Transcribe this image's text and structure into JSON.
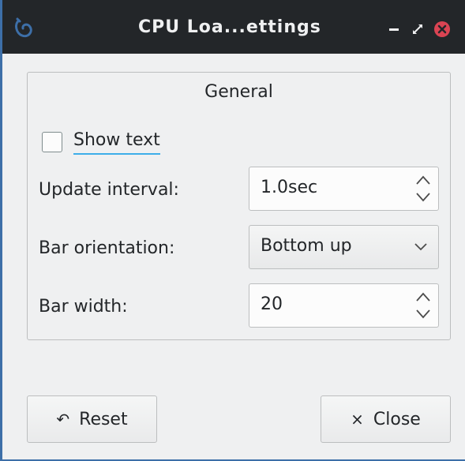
{
  "window": {
    "title": "CPU Loa...ettings"
  },
  "colors": {
    "titlebar": "#232629",
    "window_bg": "#eff0f1",
    "accent": "#3daee9",
    "close_button": "#da4453",
    "border": "#3d6fa8"
  },
  "icons": {
    "app": "app-swirl-icon",
    "minimize": "minimize-icon",
    "maximize": "maximize-icon",
    "close": "close-icon",
    "reset": "undo-icon",
    "dialog_close": "x-icon"
  },
  "group": {
    "title": "General"
  },
  "show_text": {
    "label": "Show text",
    "checked": false
  },
  "update_interval": {
    "label": "Update interval:",
    "value": "1.0sec"
  },
  "bar_orientation": {
    "label": "Bar orientation:",
    "value": "Bottom up"
  },
  "bar_width": {
    "label": "Bar width:",
    "value": "20"
  },
  "buttons": {
    "reset_label": "Reset",
    "reset_glyph": "↶",
    "close_label": "Close",
    "close_glyph": "×"
  }
}
